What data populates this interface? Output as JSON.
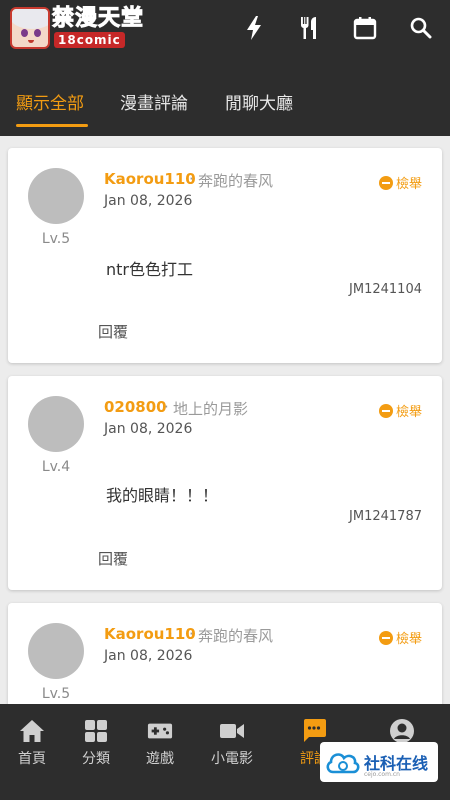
{
  "header": {
    "logo_title": "禁漫天堂",
    "logo_subtitle": "18comic",
    "icons": [
      "lightning-icon",
      "fork-knife-icon",
      "calendar-icon",
      "search-icon"
    ]
  },
  "tabs": [
    {
      "label": "顯示全部",
      "active": true
    },
    {
      "label": "漫畫評論",
      "active": false
    },
    {
      "label": "閒聊大廳",
      "active": false
    }
  ],
  "comments": [
    {
      "username": "Kaorou110",
      "separator": "·",
      "subtitle": "奔跑的春风",
      "date": "Jan 08, 2026",
      "level": "Lv.5",
      "report_label": "檢舉",
      "content": "ntr色色打工",
      "jm_id": "JM1241104",
      "reply_label": "回覆"
    },
    {
      "username": "020800",
      "separator": "·",
      "subtitle": "地上的月影",
      "date": "Jan 08, 2026",
      "level": "Lv.4",
      "report_label": "檢舉",
      "content": "我的眼睛！！！",
      "jm_id": "JM1241787",
      "reply_label": "回覆"
    },
    {
      "username": "Kaorou110",
      "separator": "·",
      "subtitle": "奔跑的春风",
      "date": "Jan 08, 2026",
      "level": "Lv.5",
      "report_label": "檢舉",
      "content": "",
      "jm_id": "",
      "reply_label": ""
    }
  ],
  "bottom_nav": [
    {
      "label": "首頁",
      "icon": "home-icon",
      "active": false
    },
    {
      "label": "分類",
      "icon": "grid-icon",
      "active": false
    },
    {
      "label": "遊戲",
      "icon": "gamepad-icon",
      "active": false
    },
    {
      "label": "小電影",
      "icon": "video-icon",
      "active": false
    },
    {
      "label": "評論",
      "icon": "comment-icon",
      "active": true
    },
    {
      "label": "",
      "icon": "profile-icon",
      "active": false
    }
  ],
  "watermark": {
    "text": "社科在线",
    "url": "cejo.com.cn"
  },
  "colors": {
    "accent": "#f39c12",
    "bar": "#2d2d2d",
    "background": "#ececec"
  }
}
